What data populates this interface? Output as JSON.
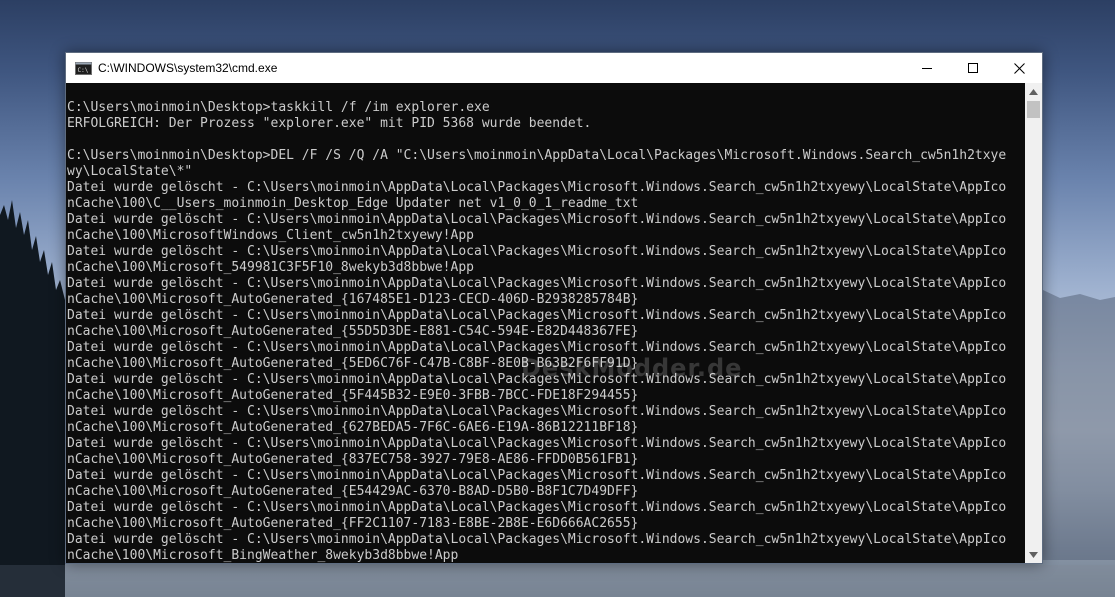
{
  "window": {
    "title": "C:\\WINDOWS\\system32\\cmd.exe",
    "icon": "cmd-icon"
  },
  "controls": {
    "minimize_icon": "minimize-icon",
    "maximize_icon": "maximize-icon",
    "close_icon": "close-icon"
  },
  "console": {
    "lines": [
      "C:\\Users\\moinmoin\\Desktop>taskkill /f /im explorer.exe",
      "ERFOLGREICH: Der Prozess \"explorer.exe\" mit PID 5368 wurde beendet.",
      "",
      "C:\\Users\\moinmoin\\Desktop>DEL /F /S /Q /A \"C:\\Users\\moinmoin\\AppData\\Local\\Packages\\Microsoft.Windows.Search_cw5n1h2txye",
      "wy\\LocalState\\*\"",
      "Datei wurde gelöscht - C:\\Users\\moinmoin\\AppData\\Local\\Packages\\Microsoft.Windows.Search_cw5n1h2txyewy\\LocalState\\AppIco",
      "nCache\\100\\C__Users_moinmoin_Desktop_Edge Updater net v1_0_0_1_readme_txt",
      "Datei wurde gelöscht - C:\\Users\\moinmoin\\AppData\\Local\\Packages\\Microsoft.Windows.Search_cw5n1h2txyewy\\LocalState\\AppIco",
      "nCache\\100\\MicrosoftWindows_Client_cw5n1h2txyewy!App",
      "Datei wurde gelöscht - C:\\Users\\moinmoin\\AppData\\Local\\Packages\\Microsoft.Windows.Search_cw5n1h2txyewy\\LocalState\\AppIco",
      "nCache\\100\\Microsoft_549981C3F5F10_8wekyb3d8bbwe!App",
      "Datei wurde gelöscht - C:\\Users\\moinmoin\\AppData\\Local\\Packages\\Microsoft.Windows.Search_cw5n1h2txyewy\\LocalState\\AppIco",
      "nCache\\100\\Microsoft_AutoGenerated_{167485E1-D123-CECD-406D-B2938285784B}",
      "Datei wurde gelöscht - C:\\Users\\moinmoin\\AppData\\Local\\Packages\\Microsoft.Windows.Search_cw5n1h2txyewy\\LocalState\\AppIco",
      "nCache\\100\\Microsoft_AutoGenerated_{55D5D3DE-E881-C54C-594E-E82D448367FE}",
      "Datei wurde gelöscht - C:\\Users\\moinmoin\\AppData\\Local\\Packages\\Microsoft.Windows.Search_cw5n1h2txyewy\\LocalState\\AppIco",
      "nCache\\100\\Microsoft_AutoGenerated_{5ED6C76F-C47B-C8BF-8E0B-B63B2F6FF91D}",
      "Datei wurde gelöscht - C:\\Users\\moinmoin\\AppData\\Local\\Packages\\Microsoft.Windows.Search_cw5n1h2txyewy\\LocalState\\AppIco",
      "nCache\\100\\Microsoft_AutoGenerated_{5F445B32-E9E0-3FBB-7BCC-FDE18F294455}",
      "Datei wurde gelöscht - C:\\Users\\moinmoin\\AppData\\Local\\Packages\\Microsoft.Windows.Search_cw5n1h2txyewy\\LocalState\\AppIco",
      "nCache\\100\\Microsoft_AutoGenerated_{627BEDA5-7F6C-6AE6-E19A-86B12211BF18}",
      "Datei wurde gelöscht - C:\\Users\\moinmoin\\AppData\\Local\\Packages\\Microsoft.Windows.Search_cw5n1h2txyewy\\LocalState\\AppIco",
      "nCache\\100\\Microsoft_AutoGenerated_{837EC758-3927-79E8-AE86-FFDD0B561FB1}",
      "Datei wurde gelöscht - C:\\Users\\moinmoin\\AppData\\Local\\Packages\\Microsoft.Windows.Search_cw5n1h2txyewy\\LocalState\\AppIco",
      "nCache\\100\\Microsoft_AutoGenerated_{E54429AC-6370-B8AD-D5B0-B8F1C7D49DFF}",
      "Datei wurde gelöscht - C:\\Users\\moinmoin\\AppData\\Local\\Packages\\Microsoft.Windows.Search_cw5n1h2txyewy\\LocalState\\AppIco",
      "nCache\\100\\Microsoft_AutoGenerated_{FF2C1107-7183-E8BE-2B8E-E6D666AC2655}",
      "Datei wurde gelöscht - C:\\Users\\moinmoin\\AppData\\Local\\Packages\\Microsoft.Windows.Search_cw5n1h2txyewy\\LocalState\\AppIco",
      "nCache\\100\\Microsoft_BingWeather_8wekyb3d8bbwe!App"
    ]
  },
  "watermark": "DeskModder.de",
  "colors": {
    "console_bg": "#0c0c0c",
    "console_text": "#cccccc",
    "titlebar_bg": "#ffffff"
  }
}
